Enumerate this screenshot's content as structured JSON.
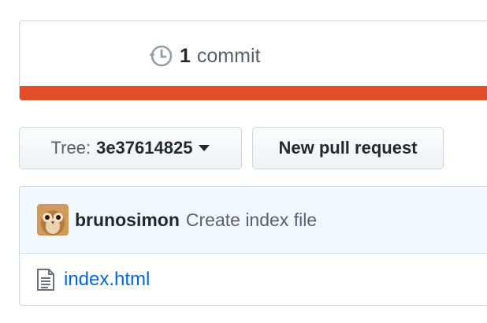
{
  "summary": {
    "commit_count": "1",
    "commit_label": "commit",
    "commit_icon": "history-icon",
    "language_bar_color": "#e34c26"
  },
  "branch_select": {
    "prefix": "Tree:",
    "value": "3e37614825",
    "icon": "caret-down-icon"
  },
  "actions": {
    "new_pull_request_label": "New pull request"
  },
  "latest_commit": {
    "author": "brunosimon",
    "message": "Create index file",
    "avatar": "avatar-image"
  },
  "files": [
    {
      "name": "index.html",
      "icon": "file-text-icon"
    }
  ],
  "colors": {
    "link": "#0366d6",
    "commit_row_bg": "#f1f8ff",
    "border": "#d1d5da"
  }
}
